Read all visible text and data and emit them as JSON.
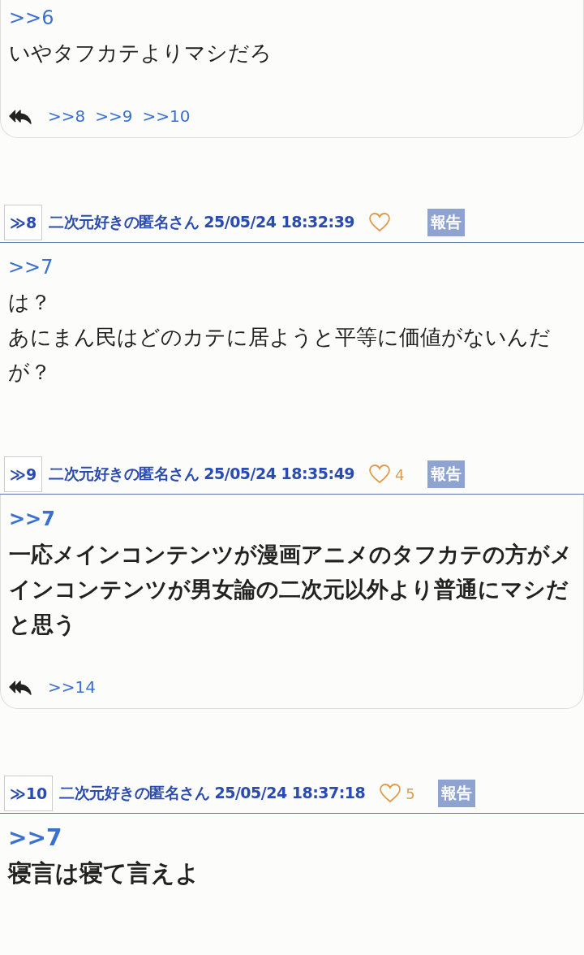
{
  "posts": [
    {
      "kind": "plain",
      "anchor": ">>6",
      "lines": [
        "いやタフカテよりマシだろ"
      ],
      "replies": [
        ">>8",
        ">>9",
        ">>10"
      ]
    },
    {
      "kind": "plain",
      "header": {
        "number": "≫8",
        "author": "二次元好きの匿名さん",
        "date": "25/05/24 18:32:39",
        "report": "報告"
      },
      "anchor": ">>7",
      "lines": [
        "は？",
        "あにまん民はどのカテに居ようと平等に価値がないんだが？"
      ]
    },
    {
      "kind": "bold",
      "header": {
        "number": "≫9",
        "author": "二次元好きの匿名さん",
        "date": "25/05/24 18:35:49",
        "likes": "4",
        "report": "報告"
      },
      "anchor": ">>7",
      "lines": [
        "一応メインコンテンツが漫画アニメのタフカテの方がメインコンテンツが男女論の二次元以外より普通にマシだと思う"
      ],
      "replies": [
        ">>14"
      ]
    },
    {
      "kind": "large",
      "header": {
        "number": "≫10",
        "author": "二次元好きの匿名さん",
        "date": "25/05/24 18:37:18",
        "likes": "5",
        "report": "報告"
      },
      "anchor": ">>7",
      "lines": [
        "寝言は寝て言えよ"
      ]
    }
  ]
}
